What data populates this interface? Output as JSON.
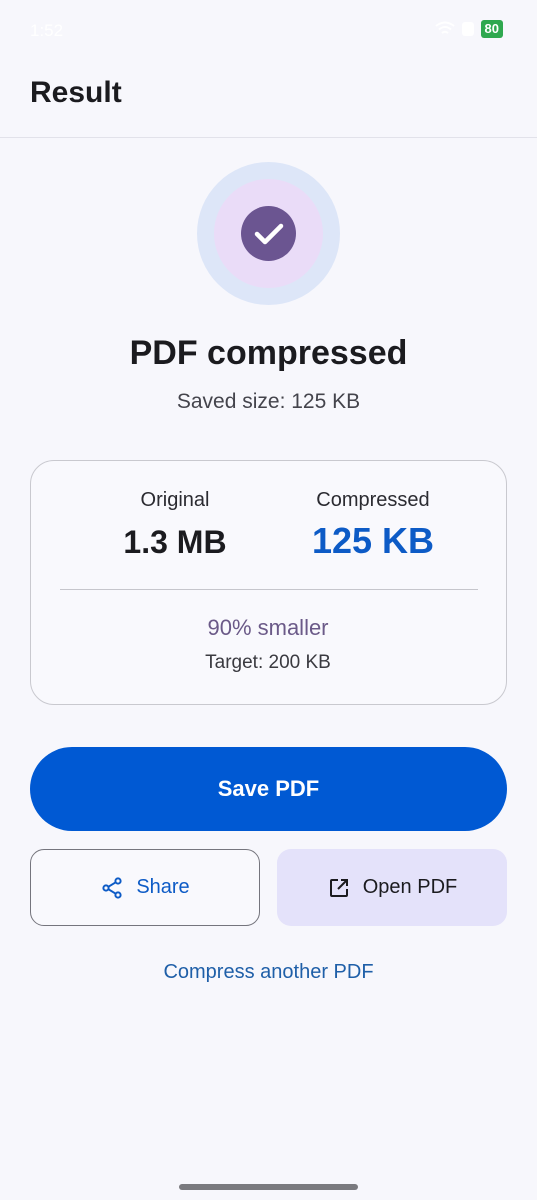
{
  "status_bar": {
    "time": "1:52",
    "battery": "80"
  },
  "app_bar": {
    "title": "Result"
  },
  "result": {
    "headline": "PDF compressed",
    "subline": "Saved size: 125 KB"
  },
  "stats": {
    "original_label": "Original",
    "original_value": "1.3 MB",
    "compressed_label": "Compressed",
    "compressed_value": "125 KB",
    "reduction": "90% smaller",
    "target": "Target: 200 KB"
  },
  "actions": {
    "save_label": "Save PDF",
    "share_label": "Share",
    "open_label": "Open PDF",
    "again_label": "Compress another PDF"
  },
  "colors": {
    "primary": "#0059d3",
    "accent_purple": "#6b5591",
    "compressed_value": "#0d5bc6"
  },
  "icons": {
    "success": "check-circle-icon",
    "share": "share-icon",
    "open": "open-external-icon"
  }
}
